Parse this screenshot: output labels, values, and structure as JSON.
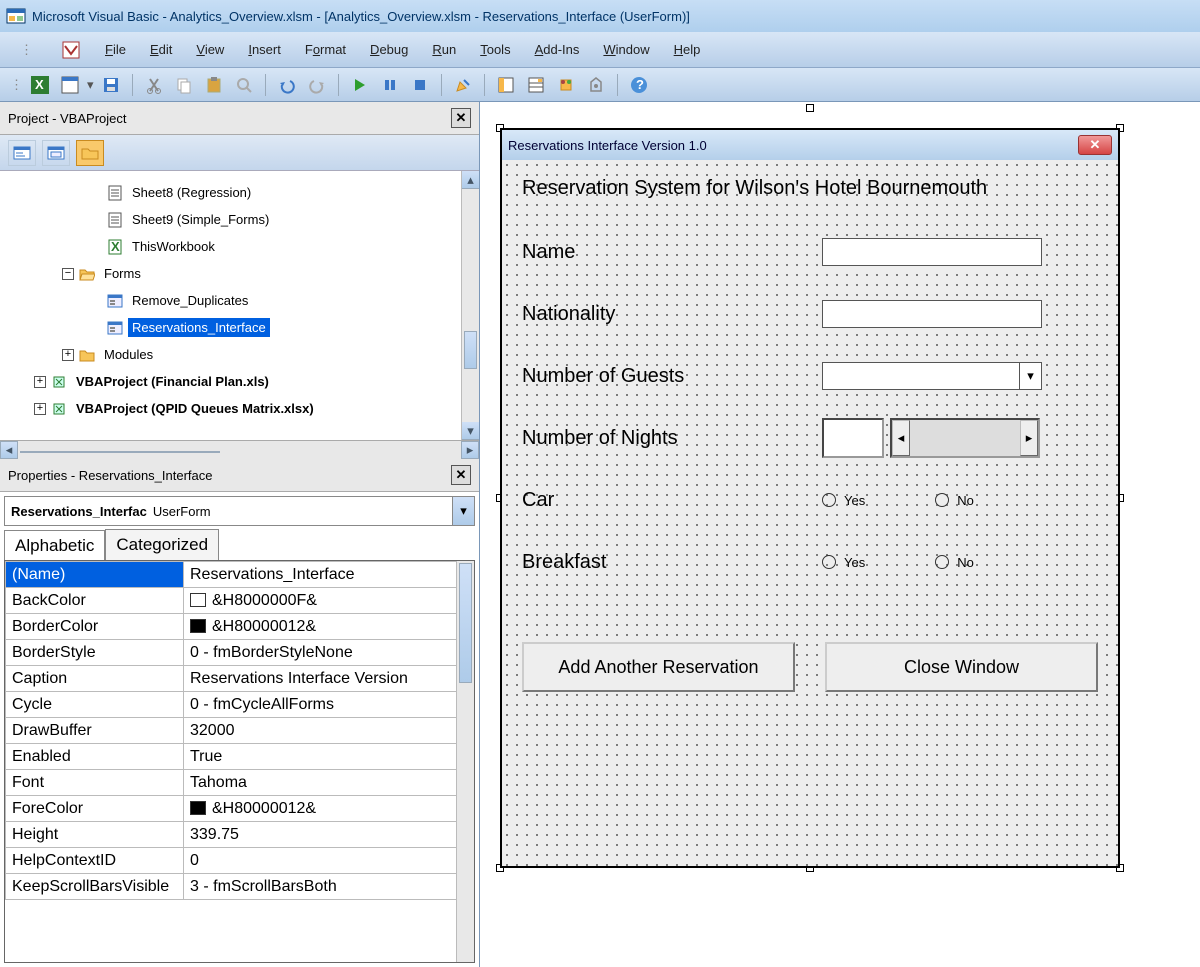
{
  "title": "Microsoft Visual Basic - Analytics_Overview.xlsm - [Analytics_Overview.xlsm - Reservations_Interface (UserForm)]",
  "menu": [
    "File",
    "Edit",
    "View",
    "Insert",
    "Format",
    "Debug",
    "Run",
    "Tools",
    "Add-Ins",
    "Window",
    "Help"
  ],
  "projectPanel": {
    "title": "Project - VBAProject"
  },
  "tree": {
    "items": [
      {
        "indent": 3,
        "icon": "sheet",
        "label": "Sheet8 (Regression)"
      },
      {
        "indent": 3,
        "icon": "sheet",
        "label": "Sheet9 (Simple_Forms)"
      },
      {
        "indent": 3,
        "icon": "wb",
        "label": "ThisWorkbook"
      },
      {
        "indent": 2,
        "icon": "folder-open",
        "box": "minus",
        "label": "Forms"
      },
      {
        "indent": 3,
        "icon": "form",
        "label": "Remove_Duplicates"
      },
      {
        "indent": 3,
        "icon": "form",
        "label": "Reservations_Interface",
        "selected": true
      },
      {
        "indent": 2,
        "icon": "folder",
        "box": "plus",
        "label": "Modules"
      },
      {
        "indent": 1,
        "icon": "proj",
        "box": "plus",
        "label": "VBAProject (Financial Plan.xls)",
        "bold": true
      },
      {
        "indent": 1,
        "icon": "proj",
        "box": "plus",
        "label": "VBAProject (QPID Queues Matrix.xlsx)",
        "bold": true
      }
    ]
  },
  "propsPanel": {
    "title": "Properties - Reservations_Interface",
    "combo_name": "Reservations_Interfac",
    "combo_type": "UserForm"
  },
  "tabs": {
    "alpha": "Alphabetic",
    "cat": "Categorized"
  },
  "properties": [
    {
      "k": "(Name)",
      "v": "Reservations_Interface",
      "sel": true
    },
    {
      "k": "BackColor",
      "v": "&H8000000F&",
      "sw": "#ffffff"
    },
    {
      "k": "BorderColor",
      "v": "&H80000012&",
      "sw": "#000000"
    },
    {
      "k": "BorderStyle",
      "v": "0 - fmBorderStyleNone"
    },
    {
      "k": "Caption",
      "v": "Reservations Interface Version"
    },
    {
      "k": "Cycle",
      "v": "0 - fmCycleAllForms"
    },
    {
      "k": "DrawBuffer",
      "v": "32000"
    },
    {
      "k": "Enabled",
      "v": "True"
    },
    {
      "k": "Font",
      "v": "Tahoma"
    },
    {
      "k": "ForeColor",
      "v": "&H80000012&",
      "sw": "#000000"
    },
    {
      "k": "Height",
      "v": "339.75"
    },
    {
      "k": "HelpContextID",
      "v": "0"
    },
    {
      "k": "KeepScrollBarsVisible",
      "v": "3 - fmScrollBarsBoth"
    }
  ],
  "form": {
    "title": "Reservations Interface Version 1.0",
    "heading": "Reservation System for Wilson's Hotel Bournemouth",
    "labels": {
      "name": "Name",
      "nat": "Nationality",
      "guests": "Number of Guests",
      "nights": "Number of Nights",
      "car": "Car",
      "breakfast": "Breakfast"
    },
    "yes": "Yes",
    "no": "No",
    "btn_add": "Add Another Reservation",
    "btn_close": "Close Window"
  }
}
